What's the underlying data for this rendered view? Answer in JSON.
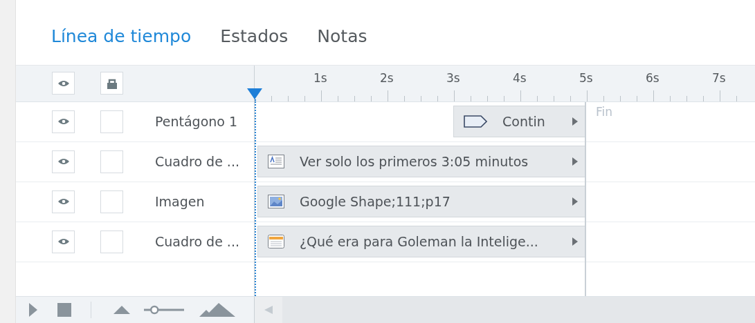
{
  "tabs": [
    {
      "label": "Línea de tiempo",
      "selected": true
    },
    {
      "label": "Estados",
      "selected": false
    },
    {
      "label": "Notas",
      "selected": false
    }
  ],
  "ruler": {
    "labels": [
      "1s",
      "2s",
      "3s",
      "4s",
      "5s",
      "6s",
      "7s"
    ]
  },
  "end_marker": "Fin",
  "zoom": {
    "level": 0.2
  },
  "layers": [
    {
      "name": "Pentágono 1",
      "visible": true,
      "locked": false,
      "item": {
        "kind": "shape",
        "label": "Contin"
      }
    },
    {
      "name": "Cuadro de ...",
      "visible": true,
      "locked": false,
      "item": {
        "kind": "text",
        "label": "Ver solo los primeros 3:05 minutos"
      }
    },
    {
      "name": "Imagen",
      "visible": true,
      "locked": false,
      "item": {
        "kind": "image",
        "label": "Google Shape;111;p17"
      }
    },
    {
      "name": "Cuadro de ...",
      "visible": true,
      "locked": false,
      "item": {
        "kind": "caption",
        "label": "¿Qué era para Goleman la Intelige..."
      }
    }
  ]
}
